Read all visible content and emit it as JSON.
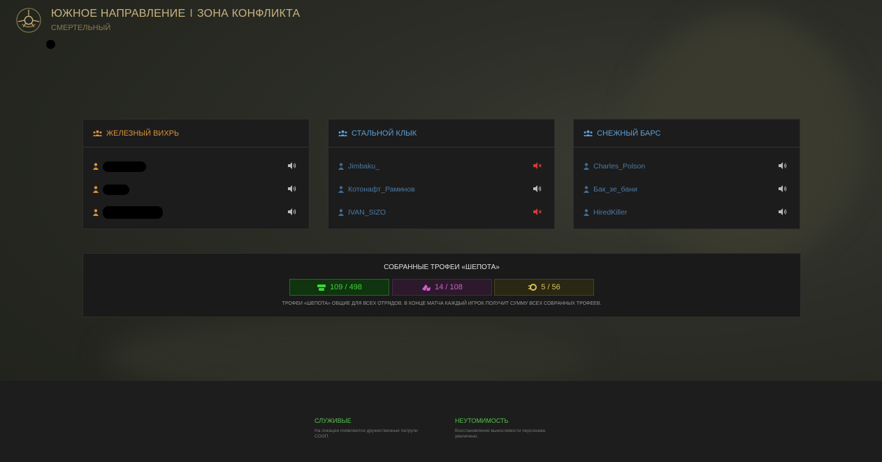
{
  "header": {
    "title_part1": "ЮЖНОЕ НАПРАВЛЕНИЕ",
    "title_separator": "I",
    "title_part2": "ЗОНА КОНФЛИКТА",
    "difficulty": "СМЕРТЕЛЬНЫЙ"
  },
  "teams": [
    {
      "name": "ЖЕЛЕЗНЫЙ ВИХРЬ",
      "color": "#d9913a",
      "players": [
        {
          "name": "",
          "redacted": true,
          "voice": "speaker-on-icon"
        },
        {
          "name": "",
          "redacted": true,
          "voice": "speaker-on-icon"
        },
        {
          "name": "",
          "redacted": true,
          "voice": "speaker-on-icon"
        }
      ]
    },
    {
      "name": "СТАЛЬНОЙ КЛЫК",
      "color": "#5d9fd6",
      "players": [
        {
          "name": "Jimbaku_",
          "voice": "speaker-muted-icon"
        },
        {
          "name": "Котонафт_Раминов",
          "voice": "speaker-on-icon"
        },
        {
          "name": "IVAN_SIZO",
          "voice": "speaker-muted-icon"
        }
      ]
    },
    {
      "name": "СНЕЖНЫЙ БАРС",
      "color": "#5d9fd6",
      "players": [
        {
          "name": "Charles_Polson",
          "voice": "speaker-on-icon"
        },
        {
          "name": "Бак_зе_бани",
          "voice": "speaker-on-icon"
        },
        {
          "name": "HiredKiller",
          "voice": "speaker-on-icon"
        }
      ]
    }
  ],
  "trophies": {
    "title": "СОБРАННЫЕ ТРОФЕИ «ШЕПОТА»",
    "counters": [
      {
        "value": "109 / 498",
        "color": "#3fd23a",
        "icon": "green-trophy-icon"
      },
      {
        "value": "14 / 108",
        "color": "#d25fc9",
        "icon": "pink-trophy-icon"
      },
      {
        "value": "5 / 56",
        "color": "#d8c256",
        "icon": "gold-trophy-icon"
      }
    ],
    "note": "ТРОФЕИ «ШЕПОТА» ОБЩИЕ ДЛЯ ВСЕХ ОТРЯДОВ. В КОНЦЕ МАТЧА КАЖДЫЙ ИГРОК ПОЛУЧИТ СУММУ ВСЕХ СОБРАННЫХ ТРОФЕЕВ."
  },
  "perks": [
    {
      "title": "СЛУЖИВЫЕ",
      "desc": "На локации появляются дружественные патрули СООП."
    },
    {
      "title": "НЕУТОМИМОСТЬ",
      "desc": "Восстановление выносливости персонажа увеличено."
    }
  ],
  "colors": {
    "accent_orange": "#d9913a",
    "accent_blue": "#5d9fd6",
    "muted_red": "#d23a3a",
    "perk_green": "#57c24f"
  }
}
